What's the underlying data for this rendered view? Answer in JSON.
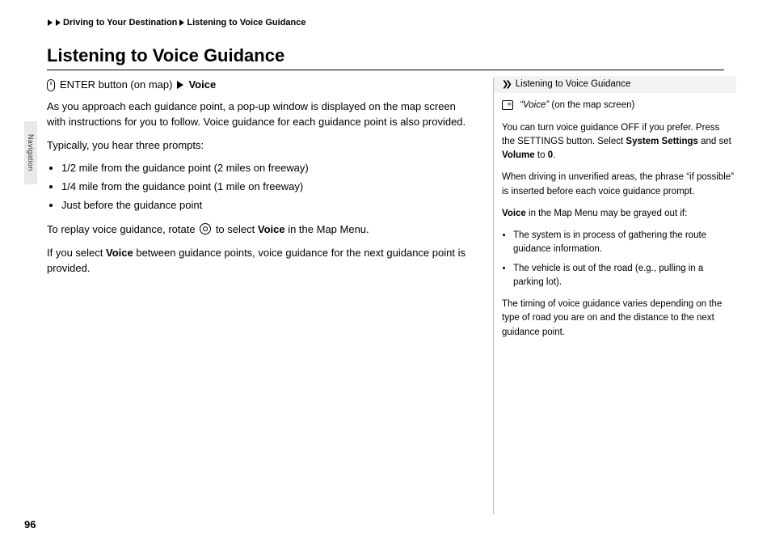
{
  "breadcrumb": {
    "a": "Driving to Your Destination",
    "b": "Listening to Voice Guidance"
  },
  "side_tab": "Navigation",
  "heading": "Listening to Voice Guidance",
  "left": {
    "step_prefix": "ENTER button (on map)",
    "step_target": "Voice",
    "p1": "As you approach each guidance point, a pop-up window is displayed on the map screen with instructions for you to follow. Voice guidance for each guidance point is also provided.",
    "p2": "Typically, you hear three prompts:",
    "bullets": {
      "b1": "1/2 mile from the guidance point (2 miles on freeway)",
      "b2": "1/4 mile from the guidance point (1 mile on freeway)",
      "b3": "Just before the guidance point"
    },
    "p3a": "To replay voice guidance, rotate",
    "p3b": "to select",
    "p3c": "Voice",
    "p3d": "in the Map Menu.",
    "p4a": "If you select",
    "p4b": "Voice",
    "p4c": "between guidance points, voice guidance for the next guidance point is provided."
  },
  "right": {
    "heading": "Listening to Voice Guidance",
    "voice_label_a": "“Voice”",
    "voice_label_b": "(on the map screen)",
    "p1a": "You can turn voice guidance OFF if you prefer. Press the SETTINGS button. Select",
    "p1b": "System Settings",
    "p1c": "and set",
    "p1d": "Volume",
    "p1e": "to",
    "p1f": "0",
    "p1g": ".",
    "p2": "When driving in unverified areas, the phrase “if possible” is inserted before each voice guidance prompt.",
    "p3a": "Voice",
    "p3b": "in the Map Menu may be grayed out if:",
    "bul1": "The system is in process of gathering the route guidance information.",
    "bul2": "The vehicle is out of the road (e.g., pulling in a parking lot).",
    "p4": "The timing of voice guidance varies depending on the type of road you are on and the distance to the next guidance point."
  },
  "page_no": "96"
}
